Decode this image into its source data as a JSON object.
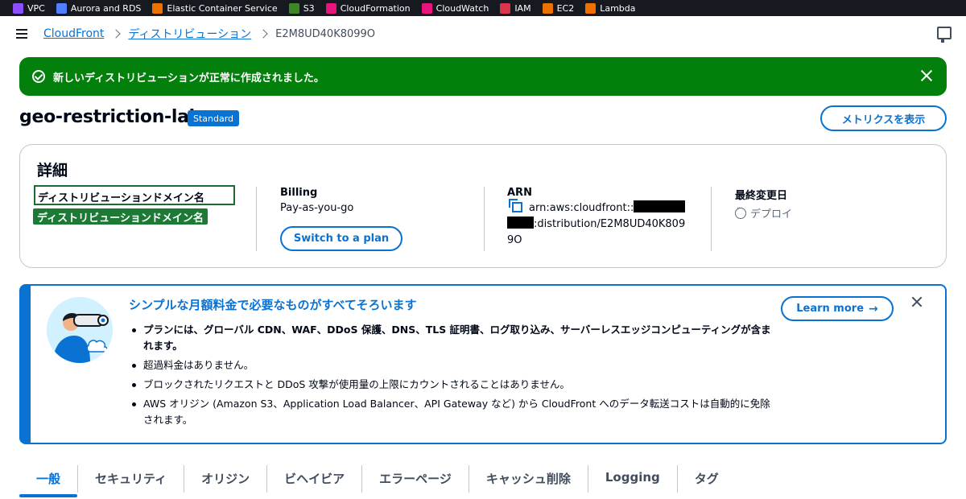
{
  "service_bar": {
    "items": [
      {
        "label": "VPC",
        "icon": "vpc-icon",
        "color": "#8c4fff"
      },
      {
        "label": "Aurora and RDS",
        "icon": "rds-icon",
        "color": "#527fff"
      },
      {
        "label": "Elastic Container Service",
        "icon": "ecs-icon",
        "color": "#ed7100"
      },
      {
        "label": "S3",
        "icon": "s3-icon",
        "color": "#3f8624"
      },
      {
        "label": "CloudFormation",
        "icon": "cloudformation-icon",
        "color": "#e7157b"
      },
      {
        "label": "CloudWatch",
        "icon": "cloudwatch-icon",
        "color": "#e7157b"
      },
      {
        "label": "IAM",
        "icon": "iam-icon",
        "color": "#dd344c"
      },
      {
        "label": "EC2",
        "icon": "ec2-icon",
        "color": "#ed7100"
      },
      {
        "label": "Lambda",
        "icon": "lambda-icon",
        "color": "#ed7100"
      }
    ]
  },
  "breadcrumb": {
    "root": "CloudFront",
    "section": "ディストリビューション",
    "current": "E2M8UD40K8099O"
  },
  "flash": {
    "message": "新しいディストリビューションが正常に作成されました。",
    "color": "#037f0c"
  },
  "header": {
    "title": "geo-restriction-lab",
    "badge": "Standard",
    "metrics_button": "メトリクスを表示"
  },
  "details": {
    "title": "詳細",
    "domain_box_text": "ディストリビューションドメイン名",
    "domain_tag_text": "ディストリビューションドメイン名",
    "billing_label": "Billing",
    "billing_value": "Pay-as-you-go",
    "plan_button": "Switch to a plan",
    "arn_label": "ARN",
    "arn_prefix": "arn:aws:cloudfront::",
    "arn_middle": ":distribution/E2M8UD40K809",
    "arn_suffix": "9O",
    "modified_label": "最終変更日",
    "modified_value": "デプロイ"
  },
  "promo": {
    "title": "シンプルな月額料金で必要なものがすべてそろいます",
    "bullets": [
      "プランには、グローバル CDN、WAF、DDoS 保護、DNS、TLS 証明書、ログ取り込み、サーバーレスエッジコンピューティングが含まれます。",
      "超過料金はありません。",
      "ブロックされたリクエストと DDoS 攻撃が使用量の上限にカウントされることはありません。",
      "AWS オリジン (Amazon S3、Application Load Balancer、API Gateway など) から CloudFront へのデータ転送コストは自動的に免除されます。"
    ],
    "learn_more": "Learn more",
    "accent_color": "#0972d3"
  },
  "tabs": [
    {
      "label": "一般",
      "active": true
    },
    {
      "label": "セキュリティ",
      "active": false
    },
    {
      "label": "オリジン",
      "active": false
    },
    {
      "label": "ビヘイビア",
      "active": false
    },
    {
      "label": "エラーページ",
      "active": false
    },
    {
      "label": "キャッシュ削除",
      "active": false
    },
    {
      "label": "Logging",
      "active": false
    },
    {
      "label": "タグ",
      "active": false
    }
  ]
}
